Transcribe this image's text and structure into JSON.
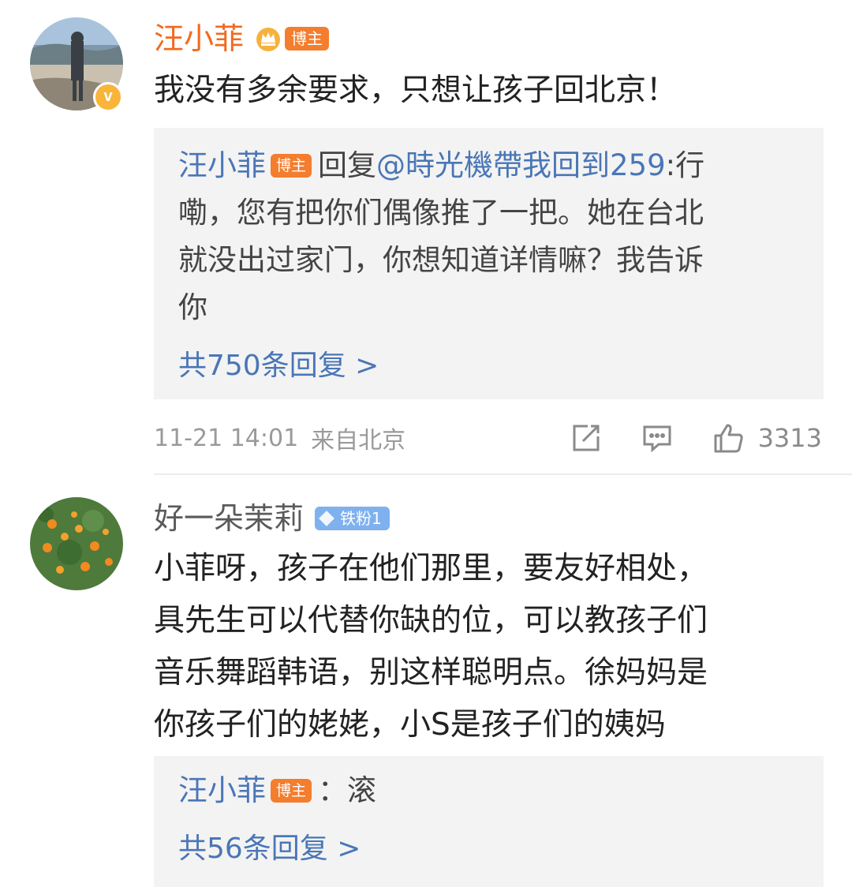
{
  "comments": [
    {
      "author": "汪小菲",
      "badge": "博主",
      "text": "我没有多余要求，只想让孩子回北京！",
      "reply": {
        "author": "汪小菲",
        "badge": "博主",
        "action": "回复",
        "mention": "@時光機帶我回到259",
        "text_line1": ":行",
        "text_line2": "嘞，您有把你们偶像推了一把。她在台北",
        "text_line3": "就没出过家门，你想知道详情嘛？我告诉",
        "text_line4": "你",
        "more": "共750条回复 >"
      },
      "meta": {
        "time": "11-21 14:01",
        "location": "来自北京",
        "likes": "3313"
      }
    },
    {
      "author": "好一朵茉莉",
      "badge": "铁粉1",
      "text_lines": [
        "小菲呀，孩子在他们那里，要友好相处，",
        "具先生可以代替你缺的位，可以教孩子们",
        "音乐舞蹈韩语，别这样聪明点。徐妈妈是",
        "你孩子们的姥姥，小S是孩子们的姨妈"
      ],
      "reply": {
        "author": "汪小菲",
        "badge": "博主",
        "text": "：滚",
        "more": "共56条回复 >"
      }
    }
  ],
  "icons": {
    "verified": "verified-v-icon",
    "crown": "crown-icon",
    "repost": "repost-icon",
    "comment": "comment-icon",
    "like": "thumbs-up-icon",
    "fan": "diamond-icon"
  },
  "colors": {
    "name": "#f16a1f",
    "link": "#4a76b6",
    "boss_badge": "#f47d2e",
    "fan_badge": "#7fb1ef",
    "reply_bg": "#f3f3f3"
  }
}
